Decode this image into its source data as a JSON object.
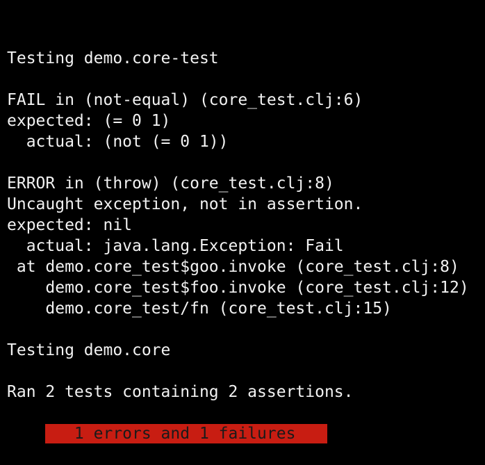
{
  "terminal": {
    "lines": [
      "Testing demo.core-test",
      "",
      "FAIL in (not-equal) (core_test.clj:6)",
      "expected: (= 0 1)",
      "  actual: (not (= 0 1))",
      "",
      "ERROR in (throw) (core_test.clj:8)",
      "Uncaught exception, not in assertion.",
      "expected: nil",
      "  actual: java.lang.Exception: Fail",
      " at demo.core_test$goo.invoke (core_test.clj:8)",
      "    demo.core_test$foo.invoke (core_test.clj:12)",
      "    demo.core_test/fn (core_test.clj:15)",
      "",
      "Testing demo.core",
      "",
      "Ran 2 tests containing 2 assertions."
    ],
    "summary": "   1 errors and 1 failures",
    "summary_color": "#c81d12",
    "background_color": "#000000",
    "text_color": "#f2f2f2"
  }
}
